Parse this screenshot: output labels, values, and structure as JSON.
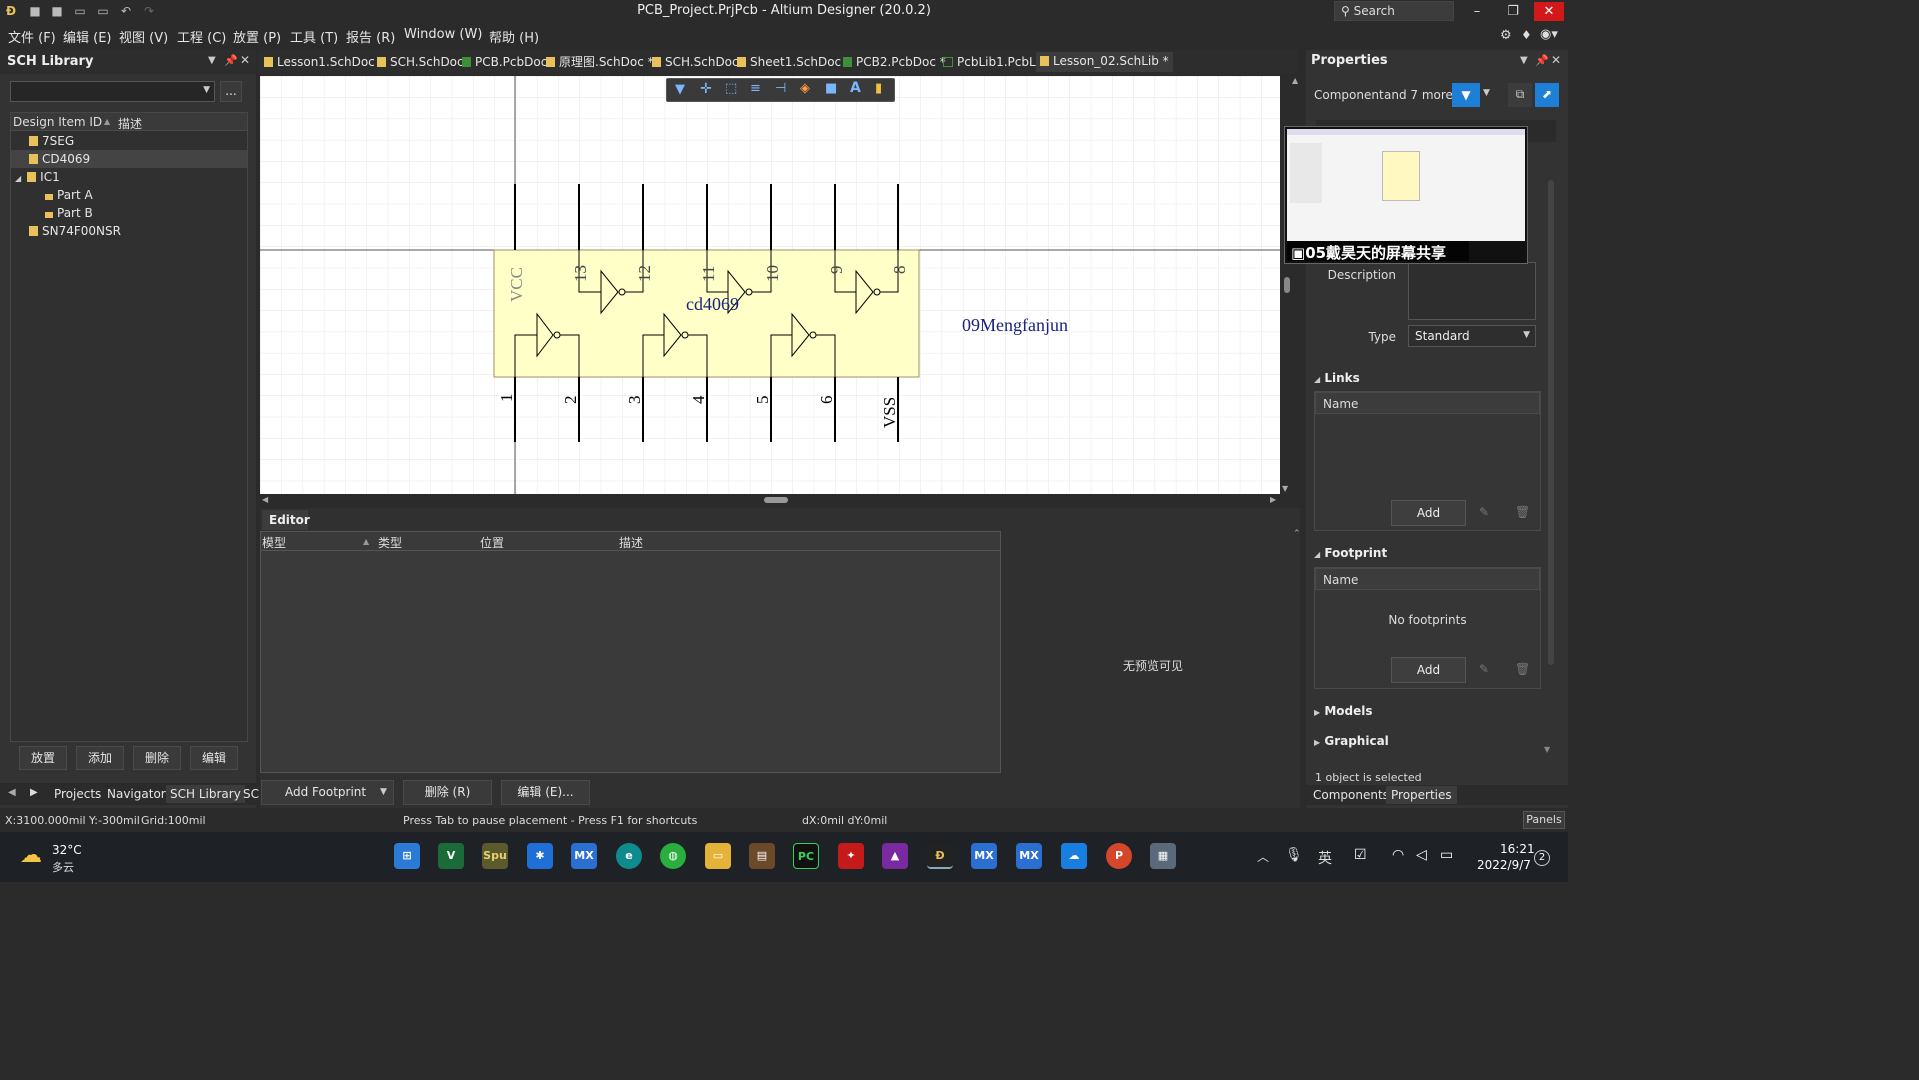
{
  "window": {
    "title": "PCB_Project.PrjPcb - Altium Designer (20.0.2)",
    "search_placeholder": "Search"
  },
  "menu": [
    "文件 (F)",
    "编辑 (E)",
    "视图 (V)",
    "工程 (C)",
    "放置 (P)",
    "工具 (T)",
    "报告 (R)",
    "Window (W)",
    "帮助 (H)"
  ],
  "sch_library": {
    "title": "SCH Library",
    "col_id": "Design Item ID",
    "col_desc": "描述",
    "items": [
      {
        "label": "7SEG"
      },
      {
        "label": "CD4069"
      },
      {
        "label": "IC1"
      },
      {
        "label": "Part A"
      },
      {
        "label": "Part B"
      },
      {
        "label": "SN74F00NSR"
      }
    ],
    "buttons": [
      "放置",
      "添加",
      "删除",
      "编辑"
    ],
    "bottom_tabs": [
      "Projects",
      "Navigator",
      "SCH Library",
      "SC"
    ]
  },
  "doc_tabs": [
    "Lesson1.SchDoc *",
    "SCH.SchDoc",
    "PCB.PcbDoc",
    "原理图.SchDoc *",
    "SCH.SchDoc",
    "Sheet1.SchDoc *",
    "PCB2.PcbDoc *",
    "PcbLib1.PcbLib",
    "Lesson_02.SchLib *"
  ],
  "schematic": {
    "component_name": "cd4069",
    "designer_text": "09Mengfanjun",
    "top_pins": [
      "VCC",
      "13",
      "12",
      "11",
      "10",
      "9",
      "8"
    ],
    "bottom_pins": [
      "1",
      "2",
      "3",
      "4",
      "5",
      "6",
      "VSS"
    ]
  },
  "editor": {
    "title": "Editor",
    "columns": [
      "模型",
      "类型",
      "位置",
      "描述"
    ],
    "no_preview": "无预览可见",
    "add_footprint": "Add Footprint",
    "delete": "删除 (R)",
    "edit": "编辑 (E)..."
  },
  "properties": {
    "title": "Properties",
    "filter_text": "Component",
    "more_text": "and 7 more)",
    "description_label": "Description",
    "type_label": "Type",
    "type_value": "Standard",
    "links_title": "Links",
    "links_col": "Name",
    "add_label": "Add",
    "footprint_title": "Footprint",
    "footprint_col": "Name",
    "no_footprints": "No footprints",
    "models_title": "Models",
    "graphical_title": "Graphical",
    "selected_text": "1 object is selected",
    "bottom_tabs": [
      "Components",
      "Properties"
    ]
  },
  "screenshare": {
    "label": "05戴昊天的屏幕共享"
  },
  "statusbar": {
    "coords": "X:3100.000mil Y:-300mil",
    "grid": "Grid:100mil",
    "hint": "Press Tab to pause placement - Press F1 for shortcuts",
    "delta": "dX:0mil dY:0mil",
    "panels": "Panels"
  },
  "taskbar": {
    "temp": "32°C",
    "weather": "多云",
    "ime": "英",
    "time": "16:21",
    "date": "2022/9/7",
    "badge": "2"
  },
  "colors": {
    "accent": "#1e7fd6",
    "component_fill": "#ffffc8",
    "component_text": "#1a237e"
  }
}
